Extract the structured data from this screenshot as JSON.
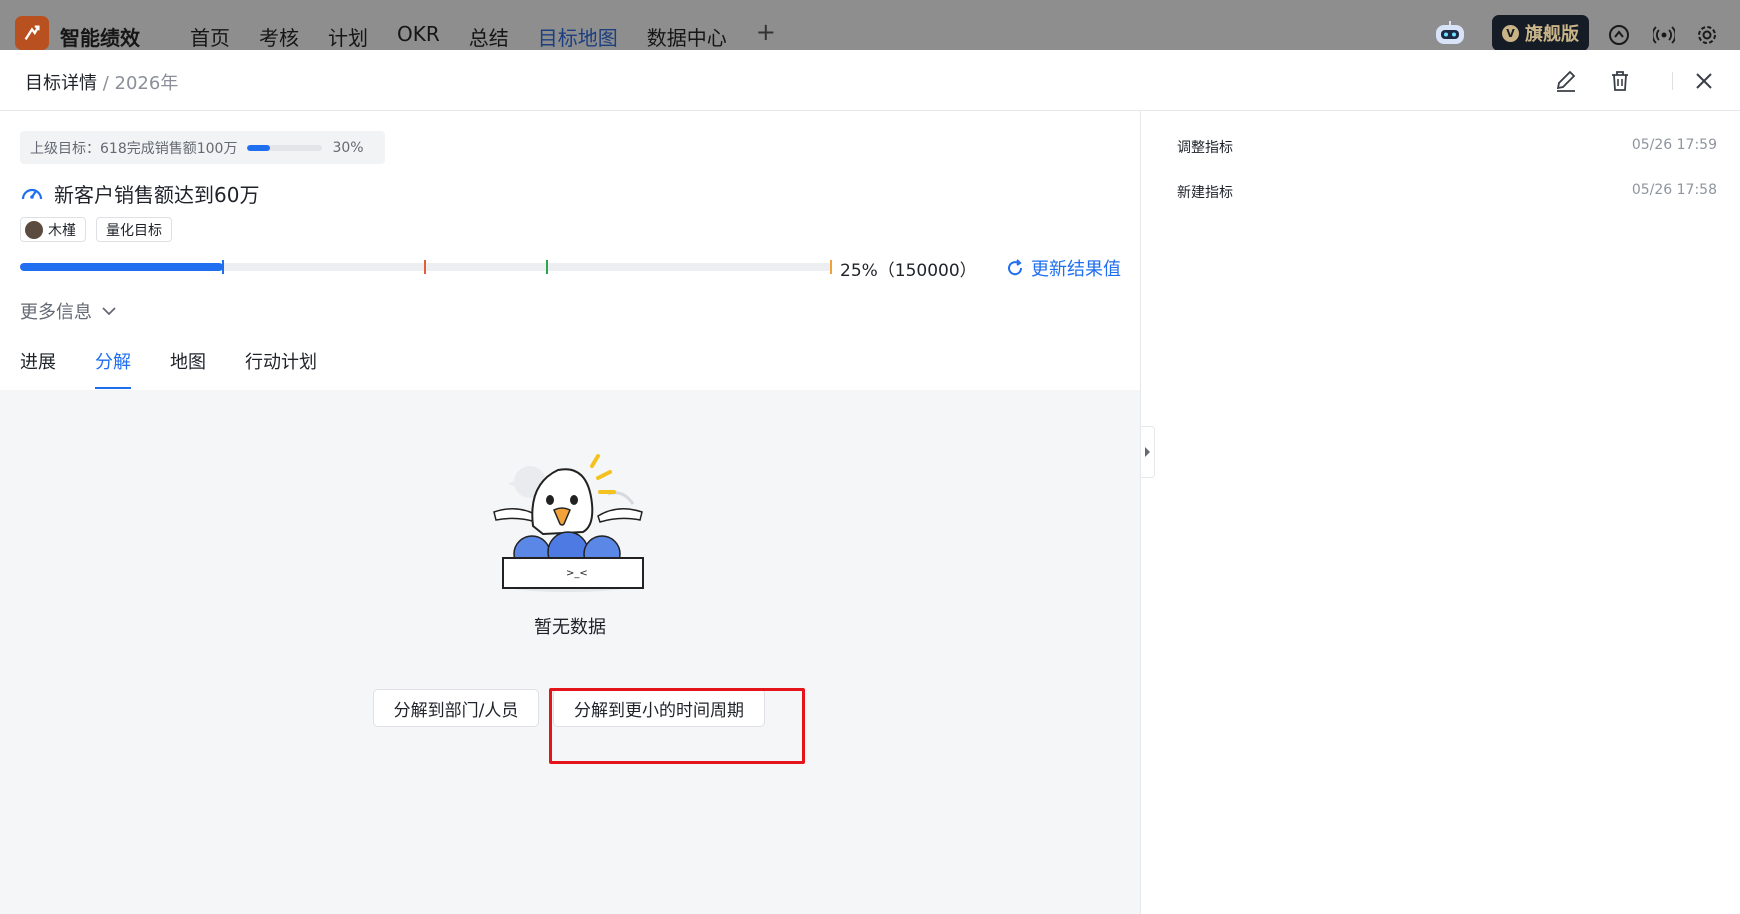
{
  "app": {
    "name": "智能绩效",
    "nav": [
      "首页",
      "考核",
      "计划",
      "OKR",
      "总结",
      "目标地图",
      "数据中心"
    ],
    "active_nav": "目标地图",
    "plus": "+",
    "edition": "旗舰版",
    "edition_badge": "V"
  },
  "header": {
    "title": "目标详情",
    "separator": " / ",
    "year": "2026年"
  },
  "goal": {
    "parent_label": "上级目标：618完成销售额100万",
    "parent_progress": 0.3,
    "parent_pct": "30%",
    "title": "新客户销售额达到60万",
    "owner": "木槿",
    "type_tag": "量化目标",
    "progress": 0.25,
    "progress_markers": [
      0.5,
      0.65,
      1.0
    ],
    "progress_text": "25%（150000）",
    "update_label": "更新结果值",
    "more_info": "更多信息"
  },
  "tabs": [
    "进展",
    "分解",
    "地图",
    "行动计划"
  ],
  "active_tab": "分解",
  "empty": {
    "text": "暂无数据",
    "btn_dept": "分解到部门/人员",
    "btn_time": "分解到更小的时间周期"
  },
  "log": [
    {
      "label": "调整指标",
      "time": "05/26 17:59"
    },
    {
      "label": "新建指标",
      "time": "05/26 17:58"
    }
  ],
  "colors": {
    "accent": "#1f6ff0",
    "highlight": "#e5131a",
    "marker_red": "#e0603b",
    "marker_green": "#2aa54a",
    "marker_orange": "#f0a13a"
  }
}
